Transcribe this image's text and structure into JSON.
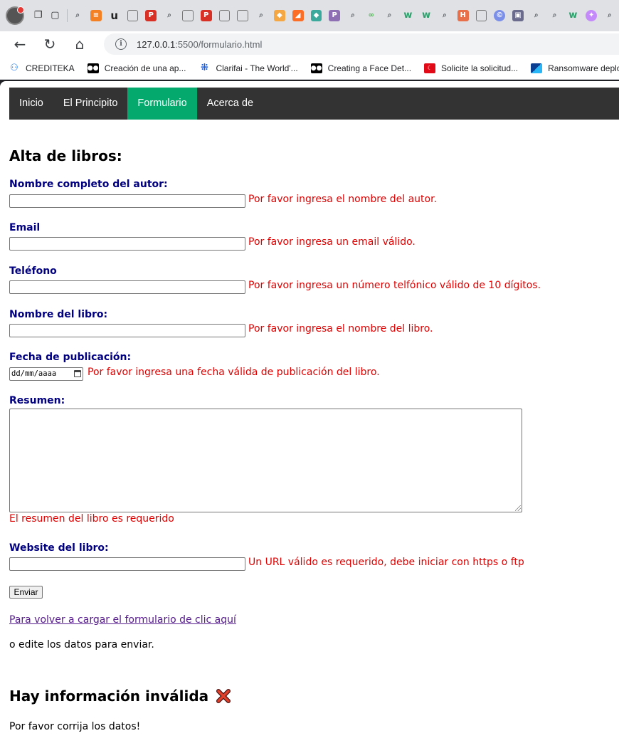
{
  "browser": {
    "address": {
      "host": "127.0.0.1",
      "rest": ":5500/formulario.html"
    },
    "bookmarks": [
      {
        "label": "CREDITEKA",
        "icon": "crediteka-icon",
        "color": "#1a73e8"
      },
      {
        "label": "Creación de una ap...",
        "icon": "medium-icon",
        "color": "#000000"
      },
      {
        "label": "Clarifai - The World'...",
        "icon": "clarifai-icon",
        "color": "#1a5fe0"
      },
      {
        "label": "Creating a Face Det...",
        "icon": "medium-icon",
        "color": "#000000"
      },
      {
        "label": "Solicite la solicitud...",
        "icon": "flag-icon",
        "color": "#e30a17"
      },
      {
        "label": "Ransomware deplo...",
        "icon": "bookmark-logo-icon",
        "color": "#0b3d91"
      }
    ]
  },
  "nav": {
    "items": [
      {
        "label": "Inicio",
        "active": false
      },
      {
        "label": "El Principito",
        "active": false
      },
      {
        "label": "Formulario",
        "active": true
      },
      {
        "label": "Acerca de",
        "active": false
      }
    ],
    "bg_color": "#333333",
    "active_color": "#04aa6d"
  },
  "form": {
    "title": "Alta de libros:",
    "author": {
      "label": "Nombre completo del autor:",
      "value": "",
      "error": "Por favor ingresa el nombre del autor."
    },
    "email": {
      "label": "Email",
      "value": "",
      "error": "Por favor ingresa un email válido."
    },
    "phone": {
      "label": "Teléfono",
      "value": "",
      "error": "Por favor ingresa un número telfónico válido de 10 dígitos."
    },
    "book_name": {
      "label": "Nombre del libro:",
      "value": "",
      "error": "Por favor ingresa el nombre del libro."
    },
    "pub_date": {
      "label": "Fecha de publicación:",
      "placeholder": "dd/mm/aaaa",
      "error": "Por favor ingresa una fecha válida de publicación del libro."
    },
    "summary": {
      "label": "Resumen:",
      "value": "",
      "error": "El resumen del libro es requerido"
    },
    "website": {
      "label": "Website del libro:",
      "value": "",
      "error": "Un URL válido es requerido, debe iniciar con https o ftp"
    },
    "submit_label": "Enviar",
    "label_color": "#000080",
    "error_color": "#e00000"
  },
  "footer": {
    "reload_link": "Para volver a cargar el formulario de clic aquí",
    "edit_note": "o edite los datos para enviar.",
    "invalid_heading": "Hay información inválida",
    "invalid_icon": "cross-mark-icon",
    "fix_note": "Por favor corrija los datos!"
  }
}
